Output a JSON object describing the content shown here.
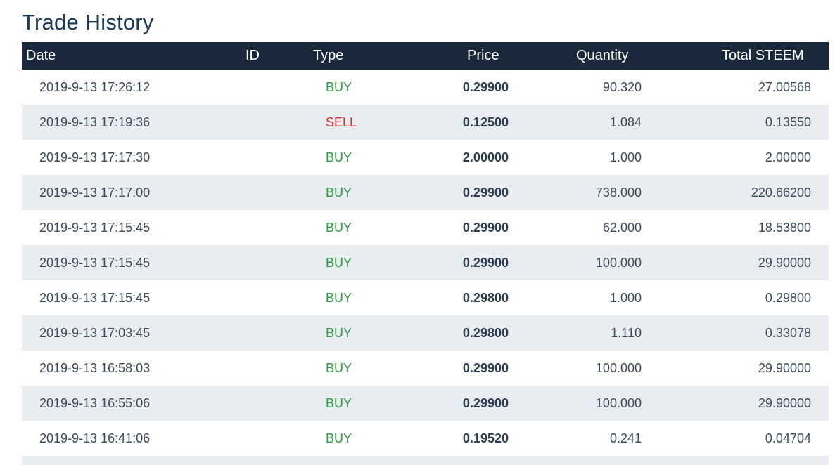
{
  "page": {
    "title": "Trade History"
  },
  "table": {
    "headers": {
      "date": "Date",
      "id": "ID",
      "type": "Type",
      "price": "Price",
      "quantity": "Quantity",
      "total": "Total STEEM"
    },
    "rows": [
      {
        "date": "2019-9-13 17:26:12",
        "type": "BUY",
        "price": "0.29900",
        "quantity": "90.320",
        "total": "27.00568"
      },
      {
        "date": "2019-9-13 17:19:36",
        "type": "SELL",
        "price": "0.12500",
        "quantity": "1.084",
        "total": "0.13550"
      },
      {
        "date": "2019-9-13 17:17:30",
        "type": "BUY",
        "price": "2.00000",
        "quantity": "1.000",
        "total": "2.00000"
      },
      {
        "date": "2019-9-13 17:17:00",
        "type": "BUY",
        "price": "0.29900",
        "quantity": "738.000",
        "total": "220.66200"
      },
      {
        "date": "2019-9-13 17:15:45",
        "type": "BUY",
        "price": "0.29900",
        "quantity": "62.000",
        "total": "18.53800"
      },
      {
        "date": "2019-9-13 17:15:45",
        "type": "BUY",
        "price": "0.29900",
        "quantity": "100.000",
        "total": "29.90000"
      },
      {
        "date": "2019-9-13 17:15:45",
        "type": "BUY",
        "price": "0.29800",
        "quantity": "1.000",
        "total": "0.29800"
      },
      {
        "date": "2019-9-13 17:03:45",
        "type": "BUY",
        "price": "0.29800",
        "quantity": "1.110",
        "total": "0.33078"
      },
      {
        "date": "2019-9-13 16:58:03",
        "type": "BUY",
        "price": "0.29900",
        "quantity": "100.000",
        "total": "29.90000"
      },
      {
        "date": "2019-9-13 16:55:06",
        "type": "BUY",
        "price": "0.29900",
        "quantity": "100.000",
        "total": "29.90000"
      },
      {
        "date": "2019-9-13 16:41:06",
        "type": "BUY",
        "price": "0.19520",
        "quantity": "0.241",
        "total": "0.04704"
      }
    ]
  },
  "colors": {
    "header_bg": "#1a2a3c",
    "buy": "#2e9b45",
    "sell": "#d93030",
    "alt_row": "#e9edf1",
    "title": "#1b3a55"
  }
}
